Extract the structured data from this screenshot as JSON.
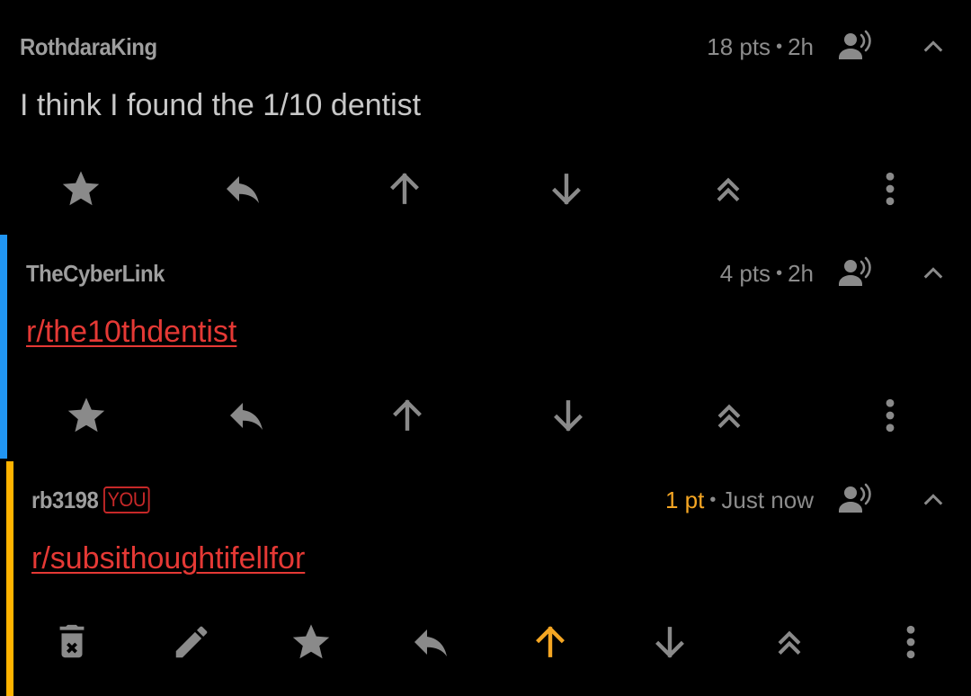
{
  "colors": {
    "background": "#000000",
    "author": "#9e9e9e",
    "meta": "#8c8c8c",
    "body": "#c8c8c8",
    "link": "#e53935",
    "icon": "#8a8a8a",
    "upvoted": "#f5a623",
    "depth1_bar": "#2196f3",
    "depth2_bar": "#ffb300",
    "you_badge": "#c62828"
  },
  "comments": [
    {
      "author": "RothdaraKing",
      "points": "18 pts",
      "separator": "•",
      "time": "2h",
      "body": "I think I found the 1/10 dentist",
      "actions": [
        "star-icon",
        "reply-icon",
        "upvote-icon",
        "downvote-icon",
        "collapse-thread-icon",
        "more-options-icon"
      ]
    },
    {
      "author": "TheCyberLink",
      "points": "4 pts",
      "separator": "•",
      "time": "2h",
      "body": "r/the10thdentist",
      "actions": [
        "star-icon",
        "reply-icon",
        "upvote-icon",
        "downvote-icon",
        "collapse-thread-icon",
        "more-options-icon"
      ]
    },
    {
      "author": "rb3198",
      "badge": "YOU",
      "points": "1 pt",
      "separator": "•",
      "time": "Just now",
      "body": "r/subsithoughtifellfor",
      "upvoted": true,
      "actions": [
        "delete-icon",
        "edit-icon",
        "star-icon",
        "reply-icon",
        "upvote-icon",
        "downvote-icon",
        "collapse-thread-icon",
        "more-options-icon"
      ]
    }
  ]
}
